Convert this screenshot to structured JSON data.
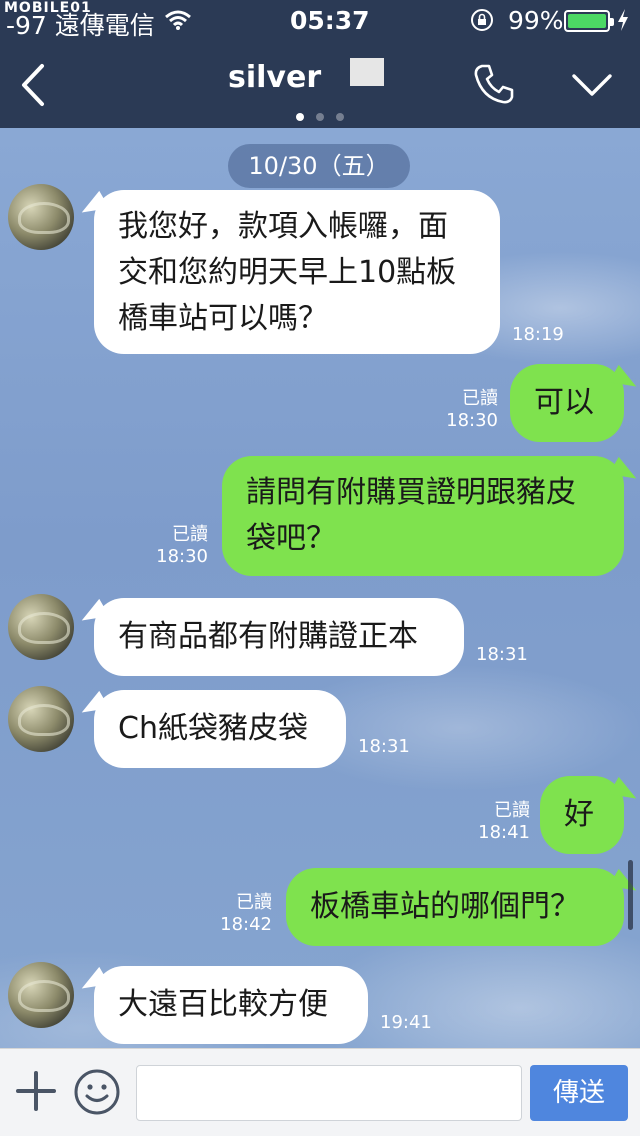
{
  "status_bar": {
    "logo": "MOBILE01",
    "carrier": "-97 遠傳電信",
    "time": "05:37",
    "battery_percent": "99%",
    "battery_level": 0.99
  },
  "header": {
    "title": "silver",
    "page_count": 3,
    "active_page": 0
  },
  "date_label": "10/30（五）",
  "messages": [
    {
      "from": "other",
      "text": "我您好，款項入帳囉，面\n交和您約明天早上10點板\n橋車站可以嗎？",
      "time": "18:19"
    },
    {
      "from": "me",
      "text": "可以",
      "read": "已讀",
      "time": "18:30"
    },
    {
      "from": "me",
      "text": "請問有附購買證明跟豬皮\n袋吧？",
      "read": "已讀",
      "time": "18:30"
    },
    {
      "from": "other",
      "text": "有商品都有附購證正本",
      "time": "18:31"
    },
    {
      "from": "other",
      "text": "Ch紙袋豬皮袋",
      "time": "18:31"
    },
    {
      "from": "me",
      "text": "好",
      "read": "已讀",
      "time": "18:41"
    },
    {
      "from": "me",
      "text": "板橋車站的哪個門？",
      "read": "已讀",
      "time": "18:42"
    },
    {
      "from": "other",
      "text": "大遠百比較方便",
      "time": "19:41"
    }
  ],
  "input": {
    "placeholder": "",
    "send_label": "傳送"
  },
  "colors": {
    "header_bg": "#2b3a55",
    "incoming_bubble": "#ffffff",
    "outgoing_bubble": "#7fe24e",
    "send_button": "#4f86de",
    "battery_fill": "#4cd964"
  }
}
